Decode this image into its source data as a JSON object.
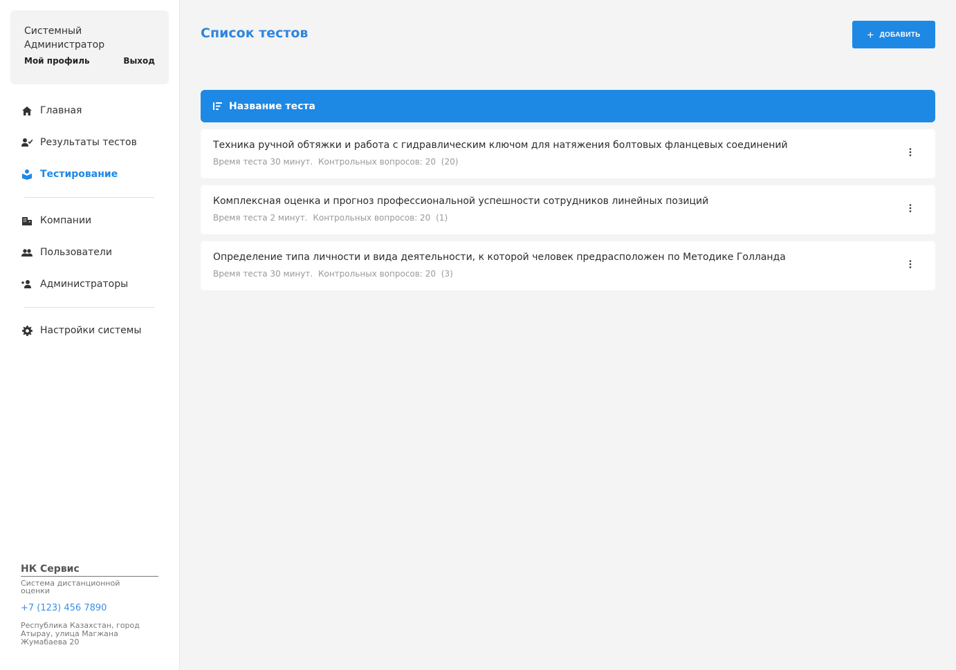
{
  "profile": {
    "name": "Системный Администратор",
    "my_profile": "Мой профиль",
    "logout": "Выход"
  },
  "nav": {
    "items": [
      {
        "label": "Главная",
        "icon": "home-icon"
      },
      {
        "label": "Результаты тестов",
        "icon": "user-check-icon"
      },
      {
        "label": "Тестирование",
        "icon": "book-reader-icon",
        "active": true
      },
      {
        "label": "Компании",
        "icon": "building-icon"
      },
      {
        "label": "Пользователи",
        "icon": "users-icon"
      },
      {
        "label": "Администраторы",
        "icon": "admin-icon"
      },
      {
        "label": "Настройки системы",
        "icon": "gear-icon"
      }
    ]
  },
  "footer": {
    "brand": "НК Сервис",
    "subtitle": "Система дистанционной оценки",
    "phone": "+7 (123) 456 7890",
    "address": "Республика Казахстан, город Атырау, улица Магжана Жумабаева 20"
  },
  "main": {
    "title": "Список тестов",
    "add_label": "ДОБАВИТЬ",
    "column_header": "Название теста"
  },
  "tests": [
    {
      "title": "Техника ручной обтяжки и работа с гидравлическим ключом для натяжения болтовых фланцевых соединений",
      "time": "Время теста 30 минут.",
      "questions": "Контрольных вопросов: 20",
      "count": "(20)"
    },
    {
      "title": "Комплексная оценка и прогноз профессиональной успешности сотрудников линейных позиций",
      "time": "Время теста 2 минут.",
      "questions": "Контрольных вопросов: 20",
      "count": "(1)"
    },
    {
      "title": "Определение типа личности и вида деятельности, к которой человек предрасположен по Методике Голланда",
      "time": "Время теста 30 минут.",
      "questions": "Контрольных вопросов: 20",
      "count": "(3)"
    }
  ],
  "colors": {
    "accent": "#1e88e5",
    "title": "#2e86de",
    "background": "#f4f4f4"
  }
}
